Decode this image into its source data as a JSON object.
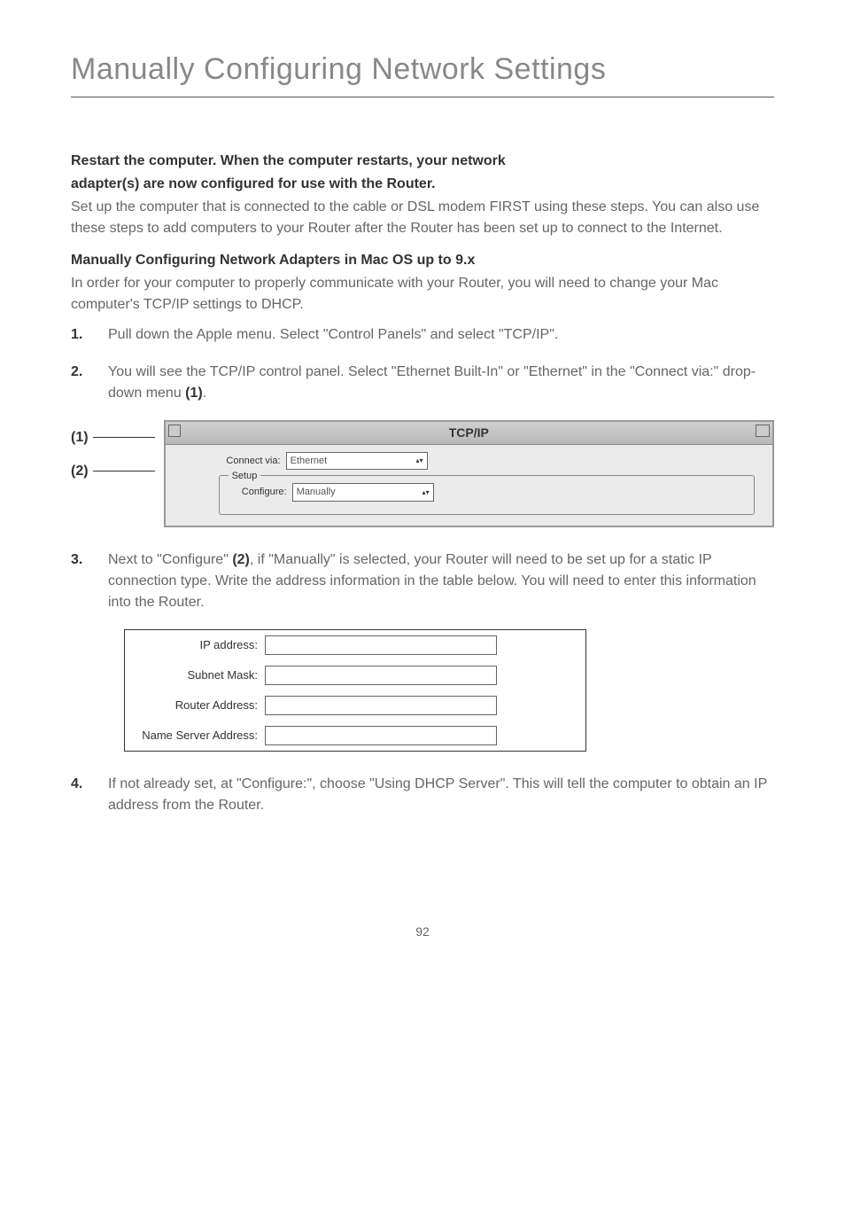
{
  "pageTitle": "Manually Configuring Network Settings",
  "restartHeading1": "Restart the computer. When the computer restarts, your network",
  "restartHeading2": "adapter(s) are now configured for use with the Router.",
  "setupText": "Set up the computer that is connected to the cable or DSL modem FIRST using these steps. You can also use these steps to add computers to your Router after the Router has been set up to connect to the Internet.",
  "manualHeading": "Manually Configuring Network Adapters in Mac OS up to 9.x",
  "manualIntro": "In order for your computer to properly communicate with your Router, you will need to change your Mac computer's TCP/IP settings to DHCP.",
  "steps": {
    "s1": {
      "num": "1.",
      "text": "Pull down the Apple menu. Select \"Control Panels\" and select \"TCP/IP\"."
    },
    "s2": {
      "num": "2.",
      "textPrefix": "You will see the TCP/IP control panel. Select \"Ethernet Built-In\" or \"Ethernet\" in the \"Connect via:\" drop-down menu ",
      "ref": "(1)",
      "textSuffix": "."
    },
    "s3": {
      "num": "3.",
      "textPrefix": "Next to \"Configure\" ",
      "ref": "(2)",
      "textSuffix": ", if \"Manually\" is selected, your Router will need to be set up for a static IP connection type. Write the address information in the table below. You will need to enter this information into the Router."
    },
    "s4": {
      "num": "4.",
      "text": "If not already set, at \"Configure:\", choose \"Using DHCP Server\". This will tell the computer to obtain an IP address from the Router."
    }
  },
  "diagram": {
    "label1": "(1)",
    "label2": "(2)",
    "title": "TCP/IP",
    "connectViaLabel": "Connect via:",
    "connectViaValue": "Ethernet",
    "setupLabel": "Setup",
    "configureLabel": "Configure:",
    "configureValue": "Manually"
  },
  "formTable": {
    "ipAddress": "IP address:",
    "subnetMask": "Subnet Mask:",
    "routerAddress": "Router Address:",
    "nameServer": "Name Server Address:"
  },
  "pageNumber": "92"
}
